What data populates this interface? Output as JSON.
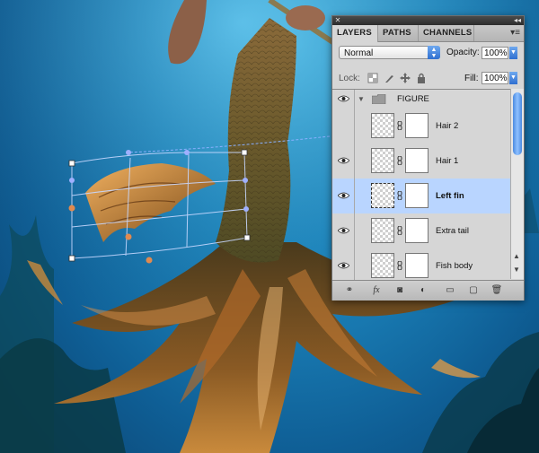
{
  "panel": {
    "tabs": [
      "LAYERS",
      "PATHS",
      "CHANNELS"
    ],
    "blend_mode": "Normal",
    "opacity_label": "Opacity:",
    "opacity_value": "100%",
    "lock_label": "Lock:",
    "fill_label": "Fill:",
    "fill_value": "100%",
    "layers": [
      {
        "name": "FIGURE",
        "type": "group",
        "visible": true,
        "selected": false
      },
      {
        "name": "Hair 2",
        "type": "layer",
        "visible": false,
        "selected": false
      },
      {
        "name": "Hair 1",
        "type": "layer",
        "visible": true,
        "selected": false
      },
      {
        "name": "Left fin",
        "type": "layer",
        "visible": true,
        "selected": true
      },
      {
        "name": "Extra tail",
        "type": "layer",
        "visible": true,
        "selected": false
      },
      {
        "name": "Fish body",
        "type": "layer",
        "visible": true,
        "selected": false
      }
    ],
    "bottom_icons": [
      "link-layers-icon",
      "fx-icon",
      "add-mask-icon",
      "adjustment-layer-icon",
      "new-group-icon",
      "new-layer-icon",
      "trash-icon"
    ],
    "bottom_glyphs": [
      "⚭",
      "fx",
      "◙",
      "◐",
      "▭",
      "▢",
      "🗑"
    ]
  },
  "colors": {
    "panel_bg": "#d6d6d6",
    "selected_row": "#b9d5ff",
    "accent_blue": "#2f6fd0",
    "water": "#1f8cc4",
    "transform_handle": "#9fb0ff",
    "warp_point": "#e08a50"
  }
}
